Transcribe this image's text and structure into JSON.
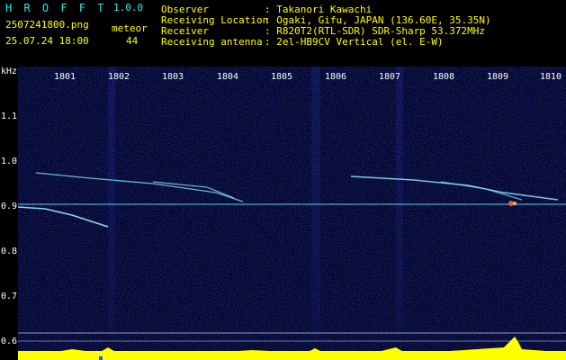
{
  "app": {
    "name": "H R O F F T",
    "version": "1.0.0"
  },
  "file": {
    "name": "2507241800.png",
    "datetime": "25.07.24 18:00"
  },
  "meteor": {
    "label": "meteor",
    "count": "44"
  },
  "info": [
    {
      "label": "Observer",
      "value": ": Takanori Kawachi"
    },
    {
      "label": "Receiving Location",
      "value": ": Ogaki, Gifu, JAPAN (136.60E, 35.35N)"
    },
    {
      "label": "Receiver",
      "value": ": R820T2(RTL-SDR) SDR-Sharp 53.372MHz"
    },
    {
      "label": "Receiving antenna",
      "value": ": 2el-HB9CV Vertical (el. E-W)"
    }
  ],
  "axis": {
    "unit": "kHz",
    "y_ticks": [
      "1.1",
      "1.0",
      "0.9",
      "0.8",
      "0.7",
      "0.6"
    ],
    "x_ticks": [
      "1801",
      "1802",
      "1803",
      "1804",
      "1805",
      "1806",
      "1807",
      "1808",
      "1809",
      "1810"
    ]
  },
  "colors": {
    "text": "#ffff00",
    "cyan": "#2ee8e8",
    "background": "#05052a",
    "trail": "#7fe0ff"
  }
}
